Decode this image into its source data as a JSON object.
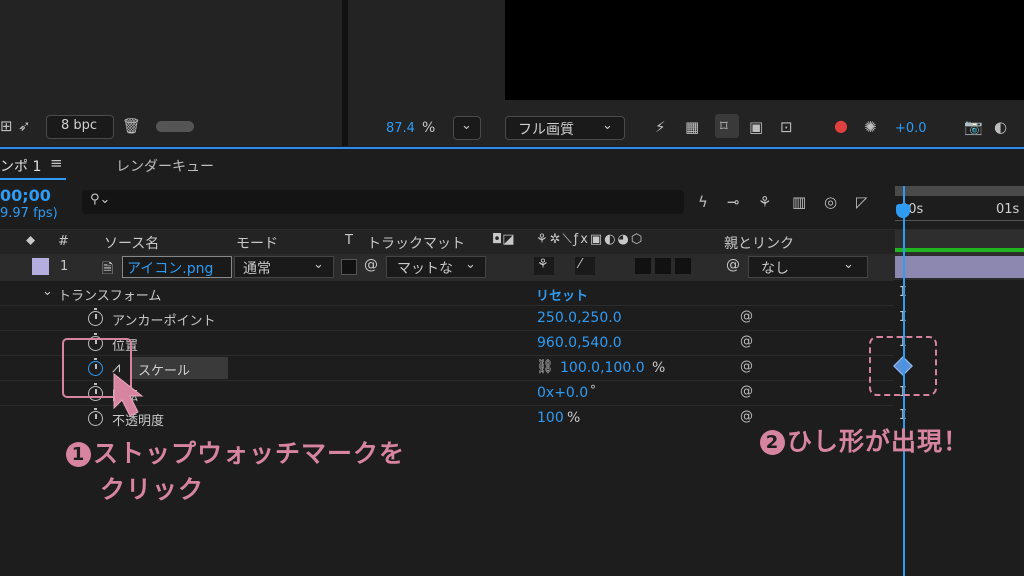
{
  "project_panel": {
    "bpc_label": "8 bpc"
  },
  "viewer": {
    "zoom_value": "87.4",
    "zoom_unit": "%",
    "resolution": "フル画質",
    "exposure": "+0.0"
  },
  "timeline": {
    "comp_tab": "ンポ 1",
    "render_queue_tab": "レンダーキュー",
    "timecode": "00;00",
    "fps": "9.97 fps)",
    "search_placeholder": "",
    "columns": {
      "number": "#",
      "source_name": "ソース名",
      "mode": "モード",
      "t": "T",
      "track_matte": "トラックマット",
      "parent_link": "親とリンク"
    },
    "ruler": {
      "t0": "00s",
      "t1": "01s"
    },
    "layer": {
      "index": "1",
      "name": "アイコン.png",
      "mode": "通常",
      "matte": "マットな",
      "parent": "なし"
    },
    "transform": {
      "label": "トランスフォーム",
      "reset": "リセット"
    },
    "properties": [
      {
        "name": "アンカーポイント",
        "value": "250.0,250.0"
      },
      {
        "name": "位置",
        "value": "960.0,540.0"
      },
      {
        "name": "スケール",
        "value": "100.0,100.0",
        "unit": "%"
      },
      {
        "name": "回転",
        "value": "0x+0.0",
        "unit": "°"
      },
      {
        "name": "不透明度",
        "value": "100",
        "unit": "%"
      }
    ]
  },
  "annotations": {
    "step1_number": "1",
    "step1_line1": "ストップウォッチマークを",
    "step1_line2": "クリック",
    "step2_number": "2",
    "step2_text": "ひし形が出現！",
    "accent_color": "#d6849f"
  }
}
